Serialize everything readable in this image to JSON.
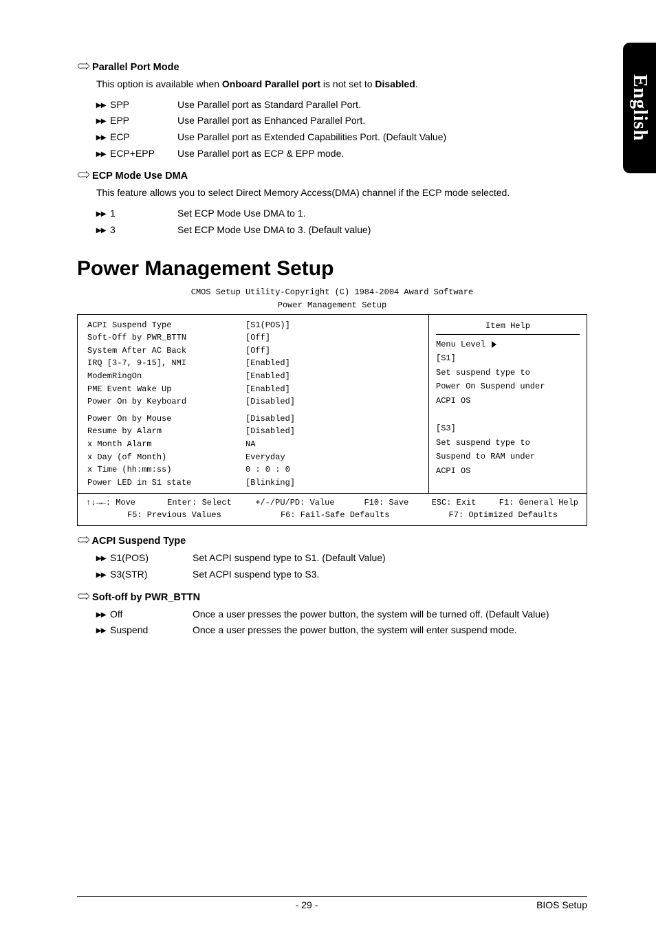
{
  "side_tab": "English",
  "parallel_port_mode": {
    "title": "Parallel Port Mode",
    "desc_pre": "This option is available when ",
    "desc_bold1": "Onboard Parallel port",
    "desc_mid": " is not set to ",
    "desc_bold2": "Disabled",
    "desc_post": ".",
    "options": [
      {
        "key": "SPP",
        "desc": "Use Parallel port as Standard Parallel Port."
      },
      {
        "key": "EPP",
        "desc": "Use Parallel port as Enhanced Parallel Port."
      },
      {
        "key": "ECP",
        "desc": "Use Parallel port as Extended Capabilities Port. (Default Value)"
      },
      {
        "key": "ECP+EPP",
        "desc": "Use Parallel port as ECP & EPP mode."
      }
    ]
  },
  "ecp_mode": {
    "title": "ECP Mode Use DMA",
    "desc": "This feature allows you to select Direct Memory Access(DMA) channel if the ECP mode selected.",
    "options": [
      {
        "key": "1",
        "desc": "Set ECP Mode Use DMA to 1."
      },
      {
        "key": "3",
        "desc": "Set ECP Mode Use DMA to 3. (Default value)"
      }
    ]
  },
  "main_heading": "Power Management Setup",
  "bios_header": {
    "line1": "CMOS Setup Utility-Copyright (C) 1984-2004 Award Software",
    "line2": "Power Management Setup"
  },
  "bios_left": [
    {
      "label": "ACPI Suspend Type",
      "val": "[S1(POS)]"
    },
    {
      "label": "Soft-Off by PWR_BTTN",
      "val": "[Off]"
    },
    {
      "label": "System After AC Back",
      "val": "[Off]"
    },
    {
      "label": "IRQ [3-7, 9-15], NMI",
      "val": "[Enabled]"
    },
    {
      "label": "ModemRingOn",
      "val": "[Enabled]"
    },
    {
      "label": "PME Event Wake Up",
      "val": "[Enabled]"
    },
    {
      "label": "Power On by Keyboard",
      "val": "[Disabled]"
    },
    {
      "label": "Power On by Mouse",
      "val": "[Disabled]"
    },
    {
      "label": "Resume by Alarm",
      "val": "[Disabled]"
    },
    {
      "label": "x Month Alarm",
      "val": "NA"
    },
    {
      "label": "x Day (of Month)",
      "val": "Everyday"
    },
    {
      "label": "x Time (hh:mm:ss)",
      "val": "0 : 0 : 0"
    },
    {
      "label": "Power LED in S1 state",
      "val": "[Blinking]"
    }
  ],
  "bios_right": {
    "item_help": "Item Help",
    "menu_level": "Menu Level",
    "lines": [
      "[S1]",
      "Set suspend type to",
      "Power On Suspend under",
      "ACPI OS",
      "",
      "[S3]",
      "Set suspend type to",
      "Suspend to RAM under",
      "ACPI OS"
    ]
  },
  "bios_bottom": {
    "r1c1": "↑↓→←: Move",
    "r1c2": "Enter: Select",
    "r1c3": "+/-/PU/PD: Value",
    "r1c4": "F10: Save",
    "r1c5": "ESC: Exit",
    "r1c6": "F1: General Help",
    "r2c1": "F5: Previous Values",
    "r2c2": "F6: Fail-Safe Defaults",
    "r2c3": "F7: Optimized Defaults"
  },
  "acpi": {
    "title": "ACPI Suspend Type",
    "options": [
      {
        "key": "S1(POS)",
        "desc": "Set ACPI suspend type to S1. (Default Value)"
      },
      {
        "key": "S3(STR)",
        "desc": "Set ACPI suspend type to S3."
      }
    ]
  },
  "soft_off": {
    "title": "Soft-off by PWR_BTTN",
    "options": [
      {
        "key": "Off",
        "desc": "Once a user presses the power button,  the system will be turned off. (Default Value)"
      },
      {
        "key": "Suspend",
        "desc": "Once a user presses the power button, the system will enter suspend mode."
      }
    ]
  },
  "footer": {
    "page": "- 29 -",
    "section": "BIOS Setup"
  }
}
